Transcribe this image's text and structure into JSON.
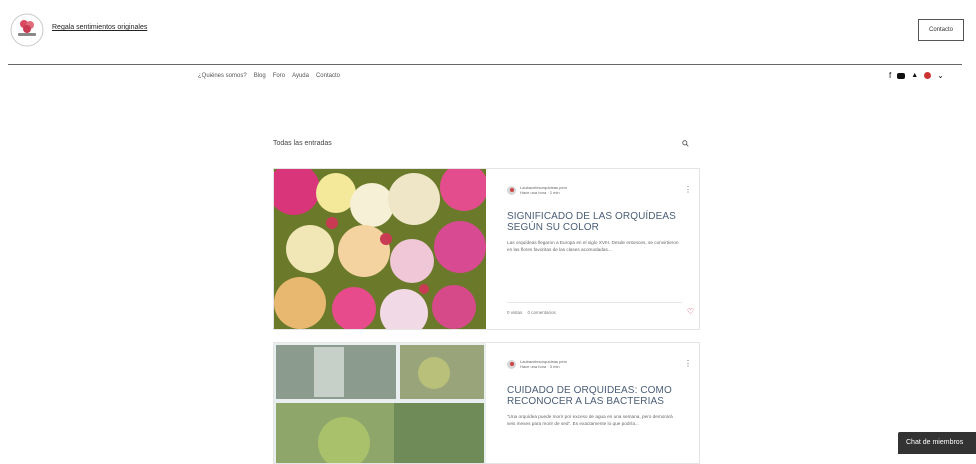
{
  "header": {
    "tagline": "Regala sentimientos originales",
    "contact_button": "Contacto"
  },
  "nav": {
    "items": [
      "¿Quiénes somos?",
      "Blog",
      "Foro",
      "Ayuda",
      "Contacto"
    ]
  },
  "social": {
    "icons": [
      "facebook-icon",
      "youtube-icon",
      "bell-icon",
      "user-icon",
      "chevron-down-icon"
    ]
  },
  "feed": {
    "heading": "Todas las entradas"
  },
  "posts": [
    {
      "author": "Laubacelesorquideas peru",
      "meta": "Hace una hora · 2 min",
      "title": "SIGNIFICADO DE LAS ORQUÍDEAS SEGÚN SU COLOR",
      "excerpt": "Las orquídeas llegaron a Europa en el siglo XVIII. Desde entonces, se convirtieron en las flores favoritas de las clases acomodadas...",
      "views": "0 vistas",
      "comments": "0 comentarios"
    },
    {
      "author": "Laubacelesorquideas peru",
      "meta": "Hace una hora · 3 min",
      "title": "CUIDADO DE ORQUIDEAS: COMO RECONOCER A LAS BACTERIAS",
      "excerpt": "“Una orquídea puede morir por exceso de agua en una semana, pero demorará seis meses para morir de sed”. Es exactamente lo que podría...",
      "views": "",
      "comments": ""
    }
  ],
  "chat": {
    "label": "Chat de miembros"
  }
}
